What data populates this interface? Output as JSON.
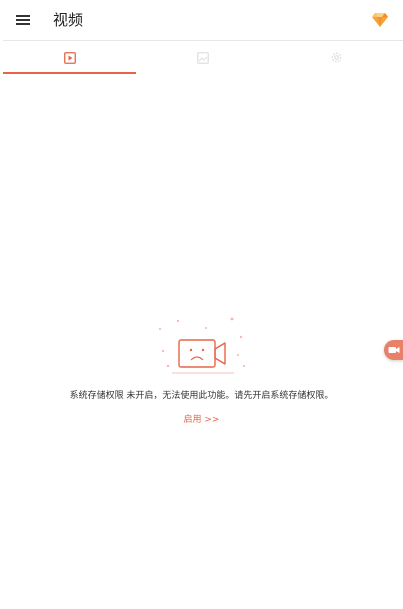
{
  "header": {
    "title": "视频",
    "menu_icon": "menu-icon",
    "premium_icon": "diamond-icon"
  },
  "tabs": [
    {
      "name": "videos",
      "icon": "video-play-icon",
      "active": true
    },
    {
      "name": "screenshots",
      "icon": "image-icon",
      "active": false
    },
    {
      "name": "settings",
      "icon": "gear-icon",
      "active": false
    }
  ],
  "empty_state": {
    "illustration_icon": "sad-camera-icon",
    "message": "系统存储权限 未开启，无法使用此功能。请先开启系统存储权限。",
    "action_label": "启用 >>"
  },
  "floating_button": {
    "icon": "record-camera-icon"
  },
  "colors": {
    "accent": "#e66548",
    "inactive_icon": "#e0e0e0",
    "title_text": "#212121",
    "body_text": "#333333"
  }
}
